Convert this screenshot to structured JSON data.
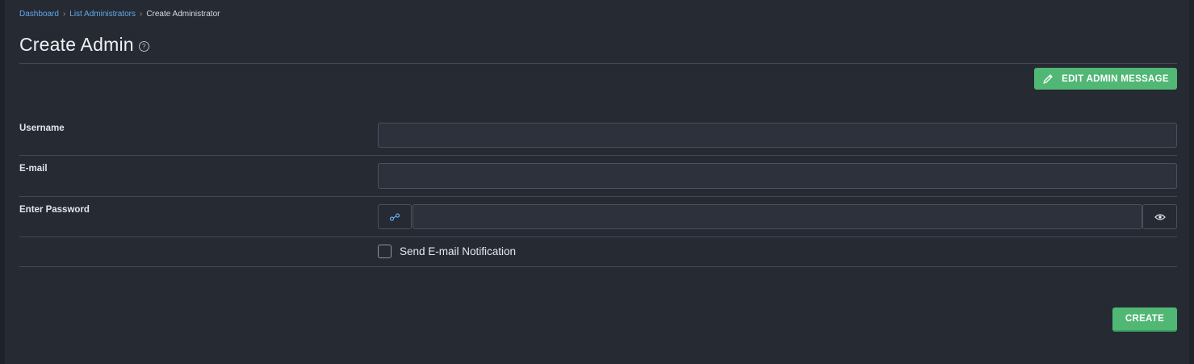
{
  "breadcrumb": {
    "items": [
      "Dashboard",
      "List Administrators"
    ],
    "current": "Create Administrator"
  },
  "page": {
    "title": "Create Admin"
  },
  "actions": {
    "edit_admin_message": "EDIT ADMIN MESSAGE",
    "create": "CREATE"
  },
  "form": {
    "username_label": "Username",
    "username_value": "",
    "email_label": "E-mail",
    "email_value": "",
    "password_label": "Enter Password",
    "password_value": "",
    "notification_label": "Send E-mail Notification",
    "notification_checked": false
  },
  "colors": {
    "accent_green": "#51b775",
    "link_blue": "#62a8ea",
    "background": "#262a33"
  },
  "icons": {
    "help": "help-circle-icon",
    "edit": "pencil-icon",
    "generate": "key-generate-icon",
    "show_password": "eye-icon"
  }
}
